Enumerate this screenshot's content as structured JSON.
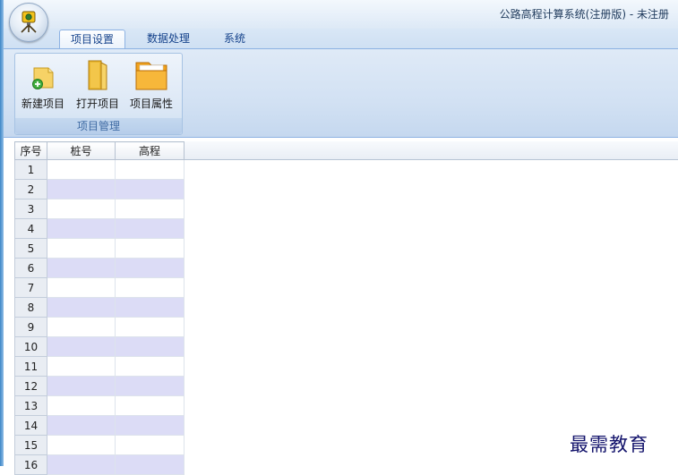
{
  "window": {
    "title": "公路高程计算系统(注册版) - 未注册"
  },
  "app_icon": "surveyor-level-icon",
  "tabs": [
    {
      "label": "项目设置",
      "active": true
    },
    {
      "label": "数据处理",
      "active": false
    },
    {
      "label": "系统",
      "active": false
    }
  ],
  "ribbon": {
    "group": {
      "label": "项目管理",
      "buttons": [
        {
          "label": "新建项目",
          "icon": "new-project-icon"
        },
        {
          "label": "打开项目",
          "icon": "open-project-icon"
        },
        {
          "label": "项目属性",
          "icon": "project-properties-icon"
        }
      ]
    }
  },
  "grid": {
    "columns": [
      "序号",
      "桩号",
      "高程"
    ],
    "rows": [
      {
        "index": "1",
        "station": "",
        "elevation": ""
      },
      {
        "index": "2",
        "station": "",
        "elevation": ""
      },
      {
        "index": "3",
        "station": "",
        "elevation": ""
      },
      {
        "index": "4",
        "station": "",
        "elevation": ""
      },
      {
        "index": "5",
        "station": "",
        "elevation": ""
      },
      {
        "index": "6",
        "station": "",
        "elevation": ""
      },
      {
        "index": "7",
        "station": "",
        "elevation": ""
      },
      {
        "index": "8",
        "station": "",
        "elevation": ""
      },
      {
        "index": "9",
        "station": "",
        "elevation": ""
      },
      {
        "index": "10",
        "station": "",
        "elevation": ""
      },
      {
        "index": "11",
        "station": "",
        "elevation": ""
      },
      {
        "index": "12",
        "station": "",
        "elevation": ""
      },
      {
        "index": "13",
        "station": "",
        "elevation": ""
      },
      {
        "index": "14",
        "station": "",
        "elevation": ""
      },
      {
        "index": "15",
        "station": "",
        "elevation": ""
      },
      {
        "index": "16",
        "station": "",
        "elevation": ""
      }
    ]
  },
  "watermark": "最需教育",
  "colors": {
    "ribbon_accent": "#15428b",
    "alt_row": "#dcdcf6",
    "watermark": "#14146c"
  }
}
